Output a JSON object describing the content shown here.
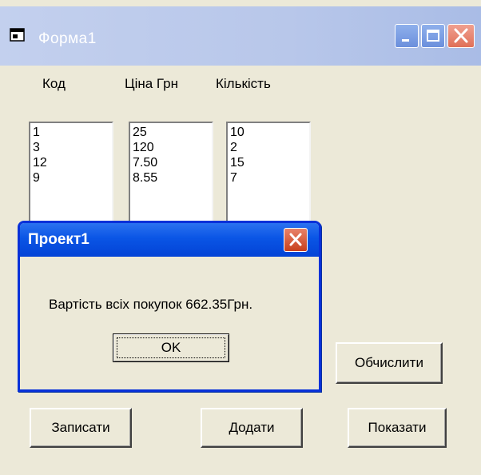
{
  "window": {
    "title": "Форма1"
  },
  "labels": {
    "code": "Код",
    "price": "Ціна Грн",
    "quantity": "Кількість"
  },
  "lists": {
    "codes": [
      "1",
      "3",
      "12",
      "9"
    ],
    "prices": [
      "25",
      "120",
      "7.50",
      "8.55"
    ],
    "quantities": [
      "10",
      "2",
      "15",
      "7"
    ]
  },
  "buttons": {
    "calculate": "Обчислити",
    "write": "Записати",
    "add": "Додати",
    "show": "Показати"
  },
  "dialog": {
    "title": "Проект1",
    "message": "Вартість всіх покупок 662.35Грн.",
    "ok": "OK"
  },
  "colors": {
    "window_face": "#ece9d8",
    "dialog_title": "#0a55e5",
    "inactive_title": "#b8c7ea"
  }
}
